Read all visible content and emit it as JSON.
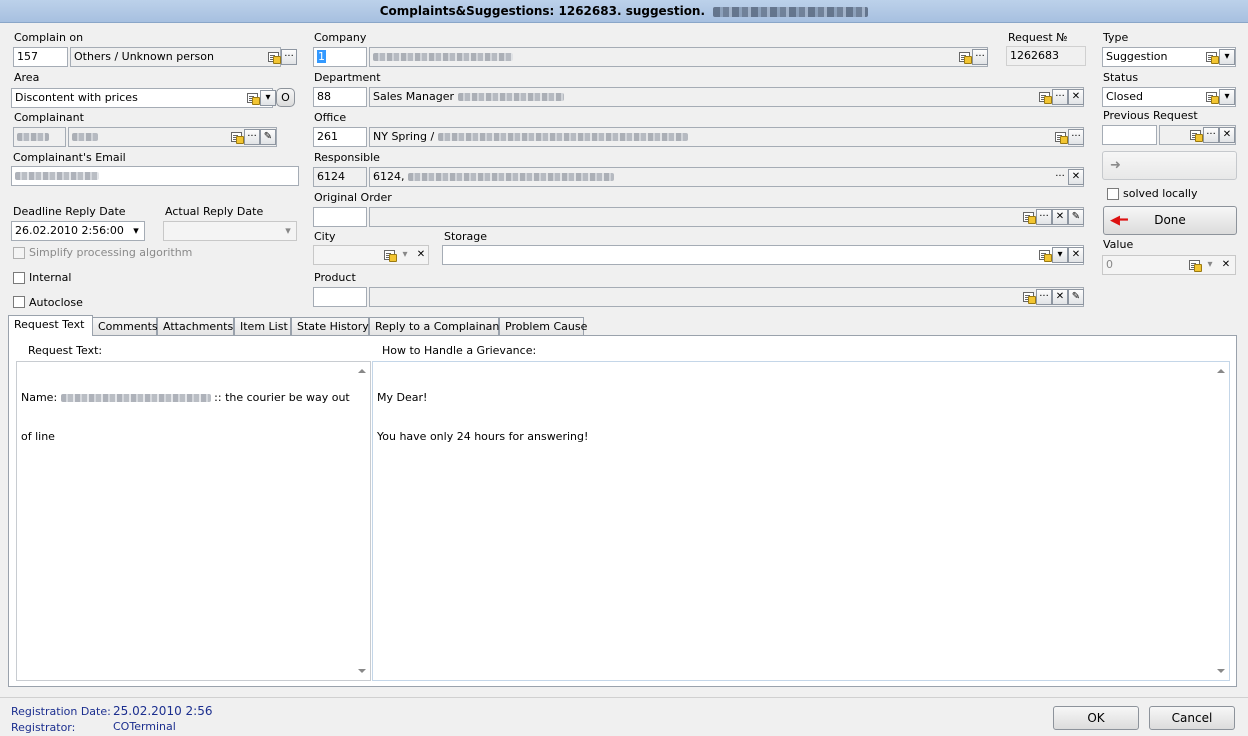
{
  "window": {
    "title": "Complaints&Suggestions: 1262683. suggestion."
  },
  "labels": {
    "complain_on": "Complain on",
    "area": "Area",
    "complainant": "Complainant",
    "complainant_email": "Complainant's Email",
    "deadline_reply_date": "Deadline Reply Date",
    "actual_reply_date": "Actual Reply Date",
    "company": "Company",
    "department": "Department",
    "office": "Office",
    "responsible": "Responsible",
    "original_order": "Original Order",
    "city": "City",
    "storage": "Storage",
    "product": "Product",
    "request_no": "Request №",
    "type": "Type",
    "status": "Status",
    "previous_request": "Previous Request",
    "value": "Value"
  },
  "fields": {
    "complain_on_code": "157",
    "complain_on_name": "Others / Unknown person",
    "area": "Discontent with prices",
    "company_code": "1",
    "department_code": "88",
    "department_name": "Sales Manager",
    "office_code": "261",
    "office_name": "NY Spring /",
    "responsible_code": "6124",
    "responsible_name": "6124,",
    "request_no": "1262683",
    "type": "Suggestion",
    "status": "Closed",
    "deadline_reply_date": "26.02.2010 2:56:00",
    "value": "0"
  },
  "buttons": {
    "area_o": "O",
    "done": "Done",
    "ok": "OK",
    "cancel": "Cancel"
  },
  "checkboxes": {
    "simplify": "Simplify processing algorithm",
    "internal": "Internal",
    "autoclose": "Autoclose",
    "solved_locally": "solved locally"
  },
  "tabs": [
    {
      "label": "Request Text"
    },
    {
      "label": "Comments"
    },
    {
      "label": "Attachments"
    },
    {
      "label": "Item List"
    },
    {
      "label": "State History"
    },
    {
      "label": "Reply to a Complainant"
    },
    {
      "label": "Problem Cause"
    }
  ],
  "request_panel": {
    "request_text_label": "Request Text:",
    "handle_label": "How to Handle a Grievance:",
    "request_name_prefix": "Name:",
    "request_name_suffix": ":: the courier be way out",
    "request_text_line2": "of line",
    "handle_line1": "My Dear!",
    "handle_line2": "You have only 24 hours for answering!"
  },
  "footer": {
    "registration_date_label": "Registration Date:",
    "registration_date": "25.02.2010 2:56",
    "registrator_label": "Registrator:",
    "registrator": "COTerminal"
  },
  "icons": {
    "lookup": "lookup-icon",
    "ellipsis": "ellipsis-icon",
    "dropdown": "dropdown-arrow-icon",
    "clear": "clear-x-icon",
    "edit": "pencil-icon",
    "back_arrow": "red-arrow-icon",
    "forward_arrow": "gray-arrow-icon"
  },
  "colors": {
    "title_bar": "#a9c2e2",
    "footer_text": "#1c2f8f",
    "selection": "#3399ff"
  }
}
